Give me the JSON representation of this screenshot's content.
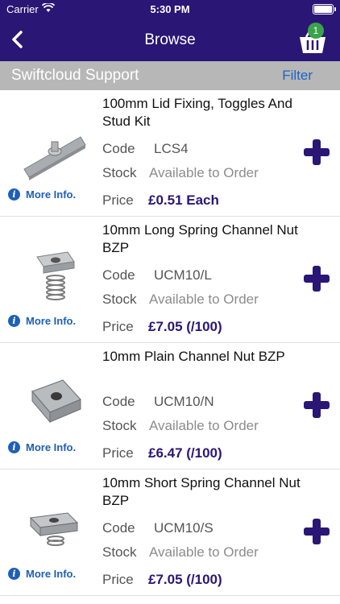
{
  "status": {
    "carrier": "Carrier",
    "time": "5:30 PM"
  },
  "nav": {
    "title": "Browse",
    "basket_count": "1"
  },
  "subbar": {
    "title": "Swiftcloud Support",
    "filter": "Filter"
  },
  "labels": {
    "code": "Code",
    "stock": "Stock",
    "price": "Price",
    "more_info": "More Info."
  },
  "products": [
    {
      "name": "100mm Lid Fixing, Toggles And Stud Kit",
      "code": "LCS4",
      "stock": "Available to Order",
      "price": "£0.51 Each"
    },
    {
      "name": "10mm Long Spring Channel Nut BZP",
      "code": "UCM10/L",
      "stock": "Available to Order",
      "price": "£7.05 (/100)"
    },
    {
      "name": "10mm Plain Channel Nut BZP",
      "code": "UCM10/N",
      "stock": "Available to Order",
      "price": "£6.47 (/100)"
    },
    {
      "name": "10mm Short Spring Channel Nut BZP",
      "code": "UCM10/S",
      "stock": "Available to Order",
      "price": "£7.05 (/100)"
    }
  ],
  "colors": {
    "brand": "#2a1675",
    "link": "#1e5fb8",
    "badge": "#3aa34a"
  }
}
